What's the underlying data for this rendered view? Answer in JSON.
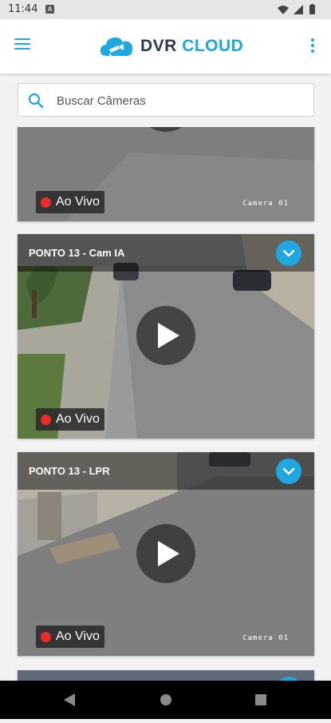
{
  "status_bar": {
    "time": "11:44",
    "notification_glyph": "A"
  },
  "app_bar": {
    "logo_primary": "DVR",
    "logo_secondary": "CLOUD",
    "menu_icon": "hamburger-icon",
    "overflow_icon": "more-vert-icon"
  },
  "search": {
    "placeholder": "Buscar Câmeras",
    "value": ""
  },
  "cards": [
    {
      "title": "",
      "live_label": "Ao Vivo",
      "camera_stamp": "Camera 01"
    },
    {
      "title": "PONTO 13 - Cam IA",
      "live_label": "Ao Vivo",
      "camera_stamp": ""
    },
    {
      "title": "PONTO 13 - LPR",
      "live_label": "Ao Vivo",
      "camera_stamp": "Camera 01"
    },
    {
      "title": "",
      "live_label": "",
      "camera_stamp": ""
    }
  ],
  "colors": {
    "accent": "#1ea7e1",
    "brand_dark": "#2d3b4f",
    "live_red": "#ee2b2b"
  }
}
